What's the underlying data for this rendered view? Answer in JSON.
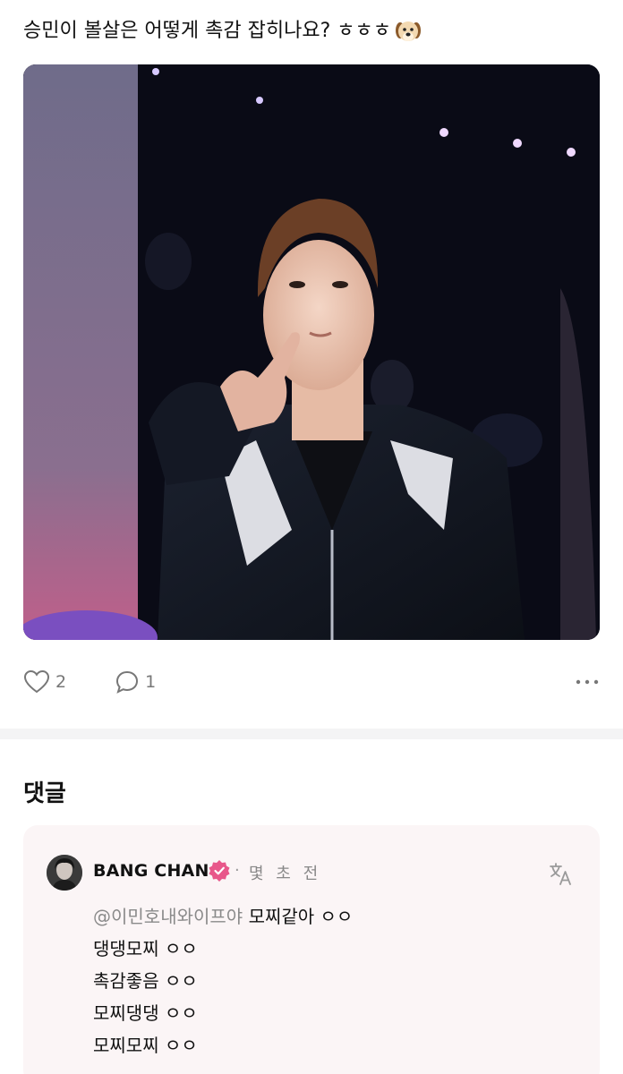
{
  "post": {
    "question": "승민이 볼살은 어떻게 촉감 잡히나요? ㅎㅎㅎ",
    "emoji_icon": "dog-face-emoji",
    "likes": "2",
    "comments": "1"
  },
  "comments_section": {
    "heading": "댓글"
  },
  "comment": {
    "author": "BANG CHAN",
    "verified_icon": "verified-badge-icon",
    "separator": "·",
    "time": "몇 초 전",
    "mention": "@이민호내와이프야",
    "lines": [
      "모찌같아 ㅇㅇ",
      "댕댕모찌 ㅇㅇ",
      "촉감좋음 ㅇㅇ",
      "모찌댕댕 ㅇㅇ",
      "모찌모찌 ㅇㅇ"
    ]
  },
  "colors": {
    "accent_pink": "#e8578a",
    "card_bg": "#fbf5f6",
    "muted": "#888888"
  }
}
